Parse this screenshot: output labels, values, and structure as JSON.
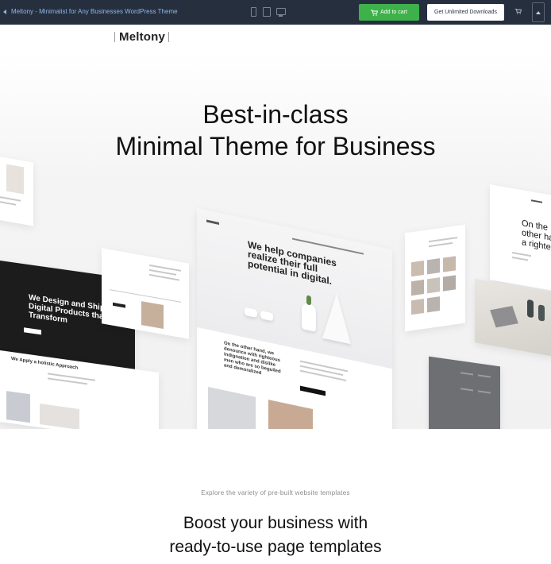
{
  "topbar": {
    "title": "Meltony - Minimalist for Any Businesses WordPress Theme",
    "add_to_cart": "Add to cart",
    "get_downloads": "Get Unlimited Downloads"
  },
  "site": {
    "logo": "Meltony"
  },
  "hero": {
    "title_line1": "Best-in-class",
    "title_line2": "Minimal Theme for Business",
    "mockups": {
      "dark_card_heading": "We Design and Ship Digital Products that Transform",
      "dark_lower_heading": "We Apply a holistic Approach",
      "main_card_heading": "We help companies realize their full potential in digital.",
      "main_card_subheading": "On the other hand, we denounce with righteous indignation and dislike men who are so beguiled and demoralized",
      "right_card_heading": "On the other hand, a righteous"
    }
  },
  "section": {
    "subtitle": "Explore the variety of pre-built website templates",
    "title_line1": "Boost your business with",
    "title_line2": "ready-to-use page templates"
  }
}
